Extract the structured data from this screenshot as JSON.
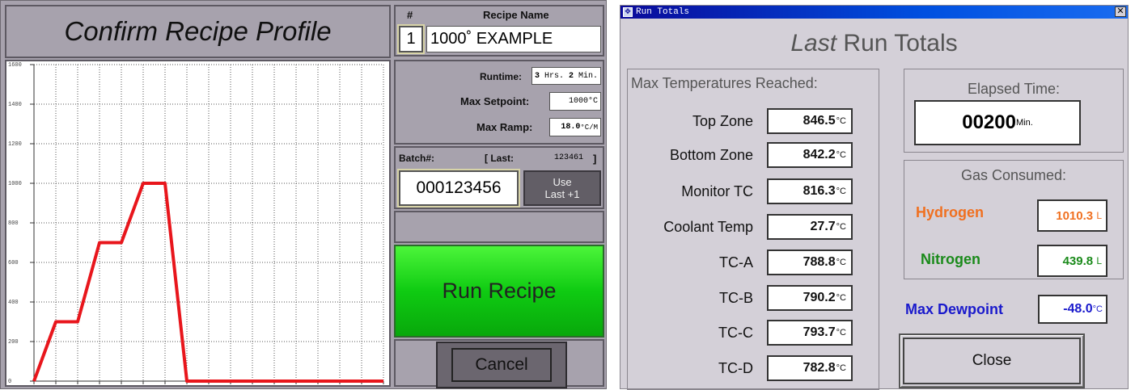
{
  "recipe": {
    "title": "Confirm Recipe Profile",
    "num_label": "#",
    "name_label": "Recipe Name",
    "number": "1",
    "name": "1000˚ EXAMPLE",
    "runtime_label": "Runtime:",
    "runtime_hours": "3",
    "runtime_hours_unit": "Hrs.",
    "runtime_minutes": "2",
    "runtime_minutes_unit": "Min.",
    "max_setpoint_label": "Max Setpoint:",
    "max_setpoint": "1000°C",
    "max_ramp_label": "Max Ramp:",
    "max_ramp": "18.0",
    "max_ramp_unit": "°C/M",
    "batch_label": "Batch#:",
    "last_label": "[ Last:",
    "last_value": "123461",
    "last_close": "]",
    "batch_value": "000123456",
    "use_last_line1": "Use",
    "use_last_line2": "Last +1",
    "run_label": "Run Recipe",
    "cancel_label": "Cancel"
  },
  "chart_data": {
    "type": "line",
    "title": "",
    "xlabel": "",
    "ylabel": "",
    "ylim": [
      0,
      1600
    ],
    "y_ticks": [
      "0",
      "200",
      "400",
      "600",
      "800",
      "1000",
      "1200",
      "1400",
      "1600"
    ],
    "grid": true,
    "line_color": "#e8161c",
    "series": [
      {
        "x": [
          0,
          1,
          2,
          3,
          4,
          5,
          6,
          7,
          16
        ],
        "y": [
          0,
          300,
          300,
          700,
          700,
          1000,
          1000,
          0,
          0
        ]
      }
    ],
    "xlim": [
      0,
      16
    ]
  },
  "run_totals": {
    "window_title": "Run Totals",
    "close_x": "✕",
    "title_italic": "Last",
    "title_rest": "Run Totals",
    "max_temps_label": "Max Temperatures Reached:",
    "temp_unit": "°C",
    "zones": [
      {
        "label": "Top Zone",
        "value": "846.5"
      },
      {
        "label": "Bottom Zone",
        "value": "842.2"
      },
      {
        "label": "Monitor TC",
        "value": "816.3"
      },
      {
        "label": "Coolant Temp",
        "value": "27.7"
      },
      {
        "label": "TC-A",
        "value": "788.8"
      },
      {
        "label": "TC-B",
        "value": "790.2"
      },
      {
        "label": "TC-C",
        "value": "793.7"
      },
      {
        "label": "TC-D",
        "value": "782.8"
      }
    ],
    "elapsed_label": "Elapsed Time:",
    "elapsed_value": "00200",
    "elapsed_unit": "Min.",
    "gas_label": "Gas Consumed:",
    "hydrogen_label": "Hydrogen",
    "hydrogen_value": "1010.3",
    "nitrogen_label": "Nitrogen",
    "nitrogen_value": "439.8",
    "gas_unit": "L",
    "dewpoint_label": "Max Dewpoint",
    "dewpoint_value": "-48.0",
    "close_label": "Close",
    "colors": {
      "hydrogen": "#f07020",
      "nitrogen": "#1a8a1a",
      "dewpoint": "#1a1acc"
    }
  }
}
